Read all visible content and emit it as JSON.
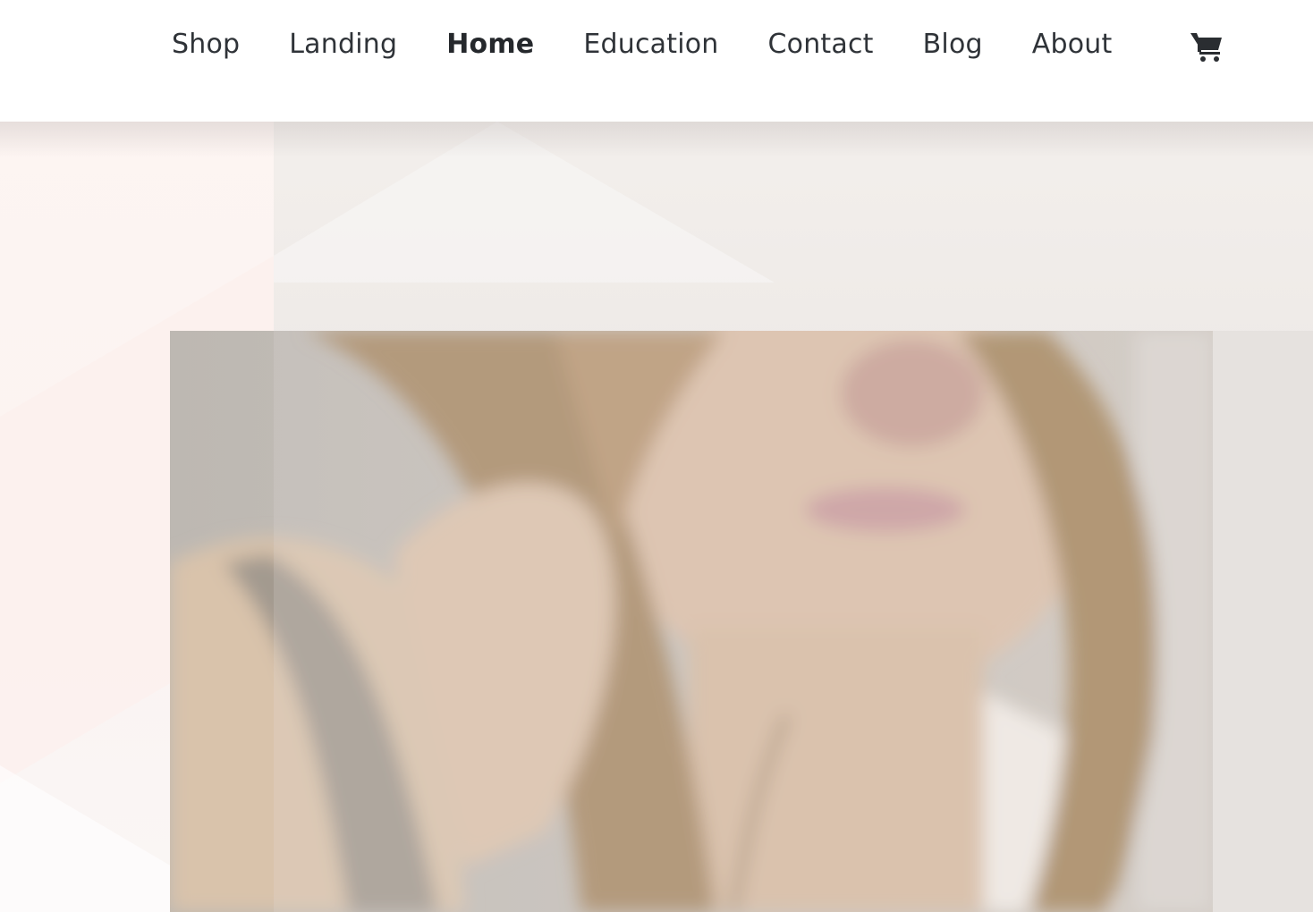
{
  "header": {
    "nav": [
      {
        "label": "Shop",
        "active": false
      },
      {
        "label": "Landing",
        "active": false
      },
      {
        "label": "Home",
        "active": true
      },
      {
        "label": "Education",
        "active": false
      },
      {
        "label": "Contact",
        "active": false
      },
      {
        "label": "Blog",
        "active": false
      },
      {
        "label": "About",
        "active": false
      }
    ],
    "cart_icon": "shopping-cart-icon"
  },
  "colors": {
    "nav_text": "#2f3338",
    "background": "#ffffff",
    "hero_left": "#fbf4f2",
    "hero_right": "#ece8e5"
  }
}
